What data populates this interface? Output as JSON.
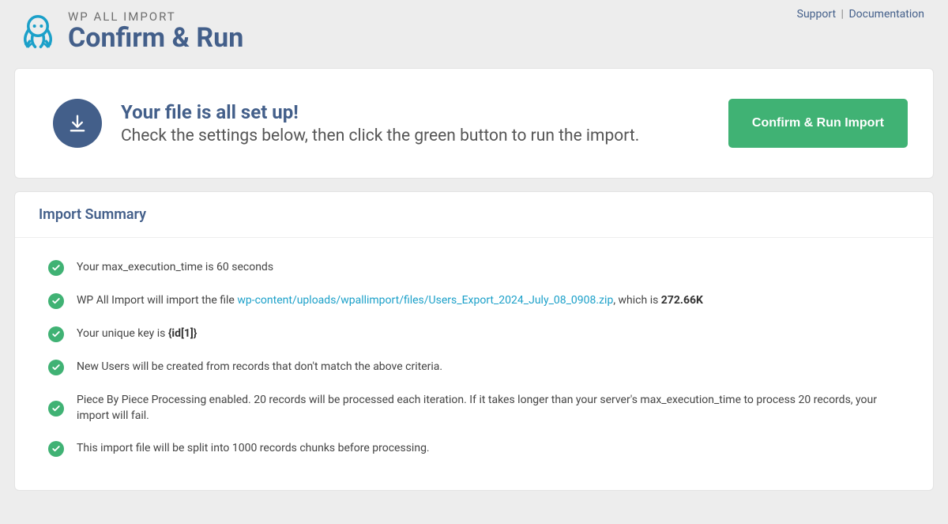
{
  "header": {
    "brand": "WP ALL IMPORT",
    "page_title": "Confirm & Run",
    "support_label": "Support",
    "docs_label": "Documentation"
  },
  "setup": {
    "title": "Your file is all set up!",
    "subtitle": "Check the settings below, then click the green button to run the import.",
    "run_button": "Confirm & Run Import"
  },
  "summary": {
    "title": "Import Summary",
    "items": {
      "exec_time": {
        "prefix": "Your max_execution_time is ",
        "value": "60 seconds"
      },
      "file": {
        "prefix": "WP All Import will import the file ",
        "link": "wp-content/uploads/wpallimport/files/Users_Export_2024_July_08_0908.zip",
        "mid": ", which is ",
        "size": "272.66K"
      },
      "unique_key": {
        "prefix": "Your unique key is ",
        "key": "{id[1]}"
      },
      "new_users": "New Users will be created from records that don't match the above criteria.",
      "piece": "Piece By Piece Processing enabled. 20 records will be processed each iteration. If it takes longer than your server's max_execution_time to process 20 records, your import will fail.",
      "split": "This import file will be split into 1000 records chunks before processing."
    }
  }
}
